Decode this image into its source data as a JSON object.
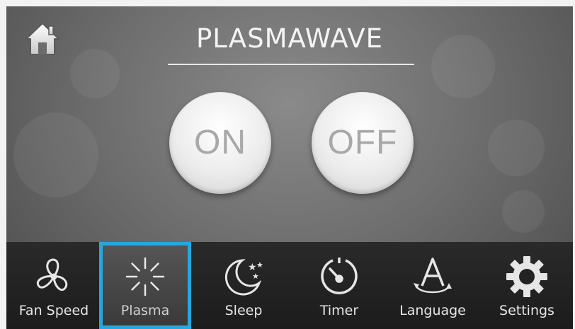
{
  "header": {
    "title": "PLASMAWAVE",
    "home_icon": "home-icon"
  },
  "power": {
    "on_label": "ON",
    "off_label": "OFF"
  },
  "nav": {
    "selected": "Plasma",
    "accent_color": "#27a7df",
    "items": [
      {
        "label": "Fan Speed",
        "icon": "fan-icon"
      },
      {
        "label": "Plasma",
        "icon": "plasma-icon"
      },
      {
        "label": "Sleep",
        "icon": "moon-stars-icon"
      },
      {
        "label": "Timer",
        "icon": "timer-icon"
      },
      {
        "label": "Language",
        "icon": "language-icon"
      },
      {
        "label": "Settings",
        "icon": "gear-icon"
      }
    ]
  }
}
